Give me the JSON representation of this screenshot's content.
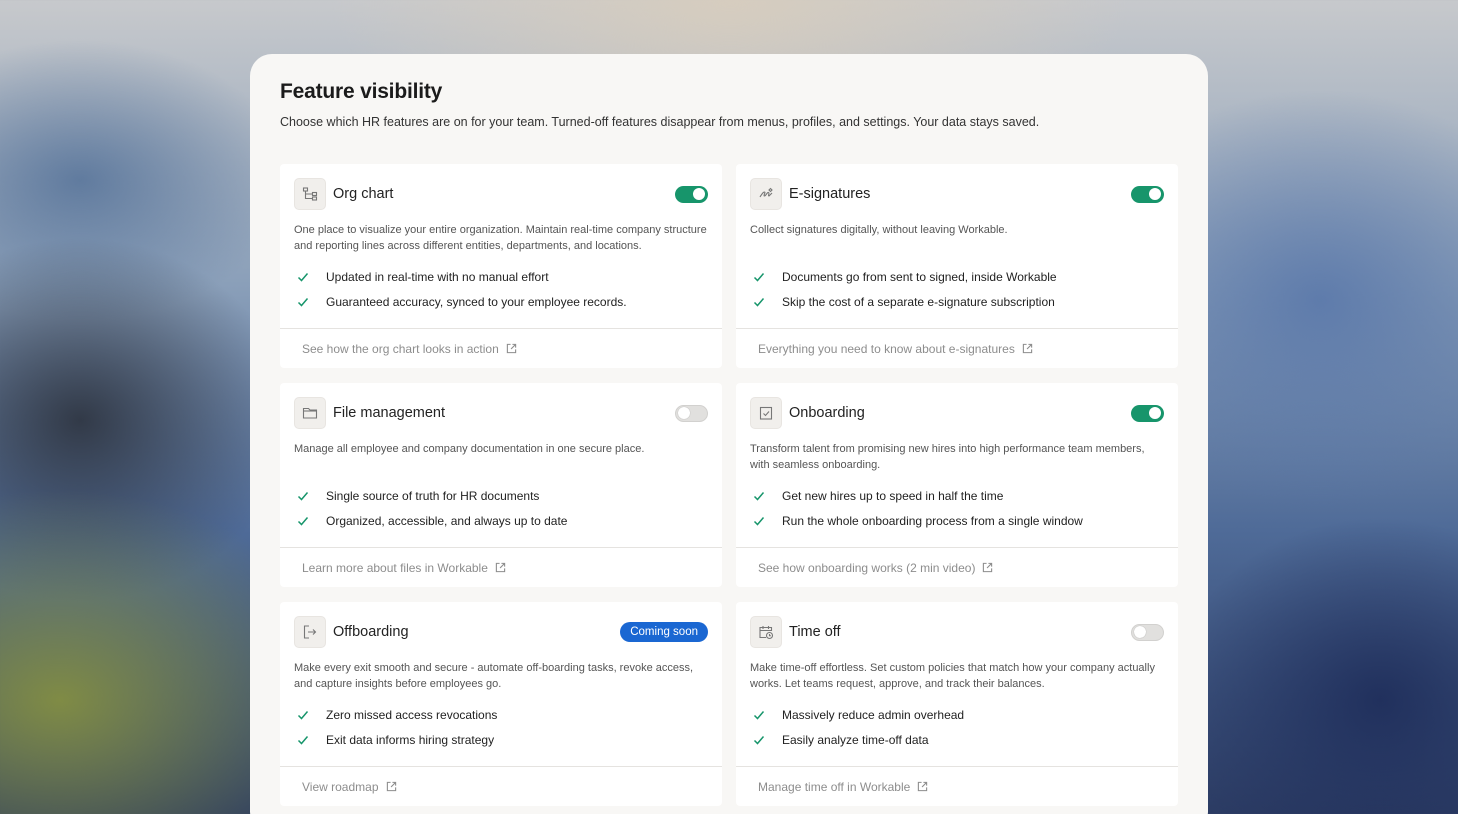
{
  "header": {
    "title": "Feature visibility",
    "subtitle": "Choose which HR features are on for your team. Turned-off features disappear from menus, profiles, and settings. Your data stays saved."
  },
  "colors": {
    "toggle_on": "#17956b",
    "toggle_off": "#e1e0de",
    "badge": "#1a67d2",
    "check": "#17956b"
  },
  "features": [
    {
      "icon": "org-chart-icon",
      "title": "Org chart",
      "state": "on",
      "description": "One place to visualize your entire organization. Maintain real-time company structure and reporting lines across different entities, departments, and locations.",
      "points": [
        "Updated in real-time with no manual effort",
        "Guaranteed accuracy, synced to your employee records."
      ],
      "link": "See how the org chart looks in action"
    },
    {
      "icon": "signature-icon",
      "title": "E-signatures",
      "state": "on",
      "description": "Collect signatures digitally, without leaving Workable.",
      "points": [
        "Documents go from sent to signed, inside Workable",
        "Skip the cost of a separate e-signature subscription"
      ],
      "link": "Everything you need to know about e-signatures"
    },
    {
      "icon": "folder-icon",
      "title": "File management",
      "state": "off",
      "description": "Manage all employee and company documentation in one secure place.",
      "points": [
        "Single source of truth for HR documents",
        "Organized, accessible, and always up to date"
      ],
      "link": "Learn more about files in Workable"
    },
    {
      "icon": "clipboard-check-icon",
      "title": "Onboarding",
      "state": "on",
      "description": "Transform talent from promising new hires into high performance team members, with seamless onboarding.",
      "points": [
        "Get new hires up to speed in half the time",
        "Run the whole onboarding process from a single window"
      ],
      "link": "See how onboarding works (2 min video)"
    },
    {
      "icon": "exit-icon",
      "title": "Offboarding",
      "state": "badge",
      "badge": "Coming soon",
      "description": "Make every exit smooth and secure - automate off-boarding tasks, revoke access, and capture insights before employees go.",
      "points": [
        "Zero missed access revocations",
        "Exit data informs hiring strategy"
      ],
      "link": "View roadmap"
    },
    {
      "icon": "calendar-clock-icon",
      "title": "Time off",
      "state": "off",
      "description": "Make time-off effortless. Set custom policies that match how your company actually works. Let teams request, approve, and track their balances.",
      "points": [
        "Massively reduce admin overhead",
        "Easily analyze time-off data"
      ],
      "link": "Manage time off in Workable"
    }
  ]
}
